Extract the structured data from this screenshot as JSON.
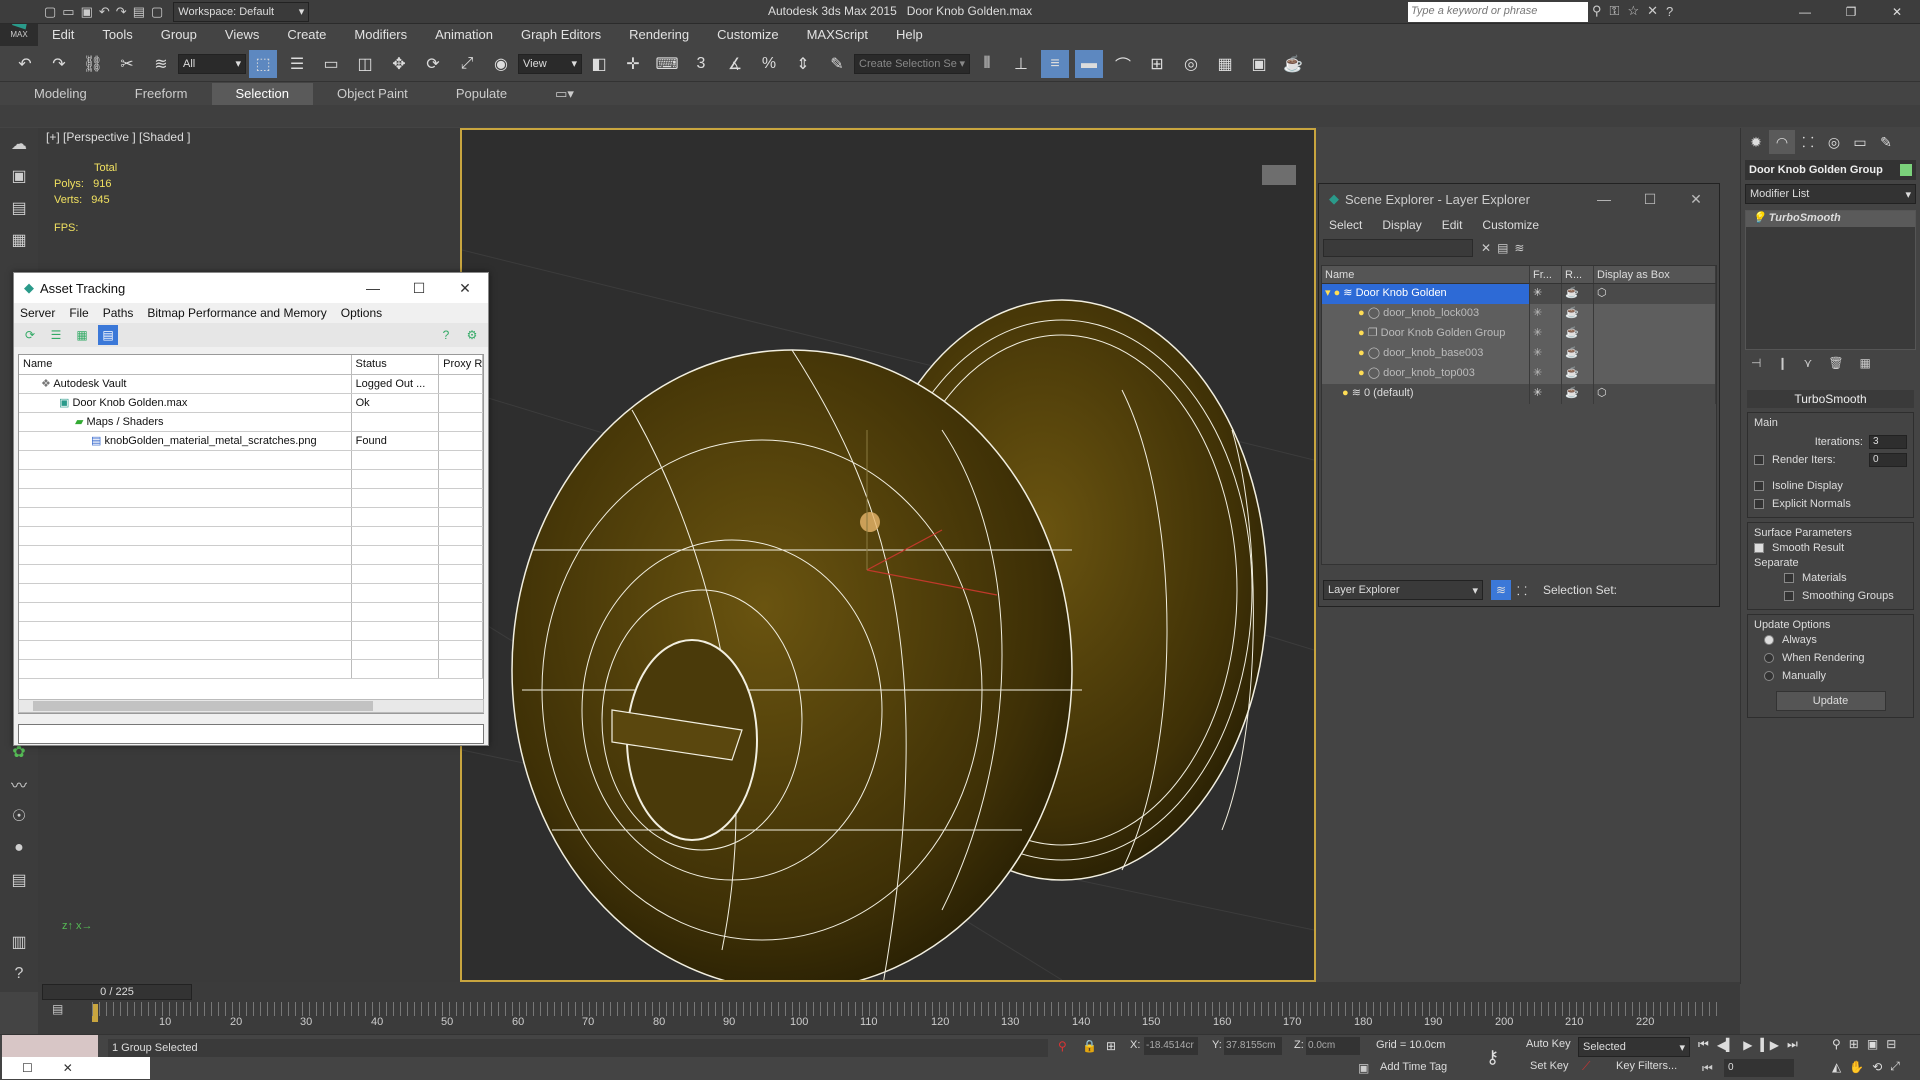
{
  "app": {
    "title": "Autodesk 3ds Max  2015",
    "file": "Door Knob Golden.max",
    "workspace": "Workspace: Default",
    "search_placeholder": "Type a keyword or phrase",
    "logo_text": "MAX"
  },
  "menu": [
    "Edit",
    "Tools",
    "Group",
    "Views",
    "Create",
    "Modifiers",
    "Animation",
    "Graph Editors",
    "Rendering",
    "Customize",
    "MAXScript",
    "Help"
  ],
  "toolbar": {
    "filter": "All",
    "refcoord": "View",
    "selset_placeholder": "Create Selection Se",
    "snaps": [
      "3",
      "n",
      "%",
      "n"
    ]
  },
  "ribbon": {
    "tabs": [
      "Modeling",
      "Freeform",
      "Selection",
      "Object Paint",
      "Populate"
    ],
    "active": "Selection"
  },
  "viewport": {
    "label": "[+] [Perspective ] [Shaded ]",
    "stats": {
      "total": "Total",
      "polys_label": "Polys:",
      "polys": "916",
      "verts_label": "Verts:",
      "verts": "945",
      "fps_label": "FPS:"
    }
  },
  "asset_tracking": {
    "title": "Asset Tracking",
    "menus": [
      "Server",
      "File",
      "Paths",
      "Bitmap Performance and Memory",
      "Options"
    ],
    "columns": [
      "Name",
      "Status",
      "Proxy R"
    ],
    "rows": [
      {
        "name": "Autodesk Vault",
        "status": "Logged Out ..."
      },
      {
        "name": "Door Knob Golden.max",
        "status": "Ok"
      },
      {
        "name": "Maps / Shaders",
        "status": ""
      },
      {
        "name": "knobGolden_material_metal_scratches.png",
        "status": "Found"
      }
    ]
  },
  "scene_explorer": {
    "title": "Scene Explorer - Layer Explorer",
    "menus": [
      "Select",
      "Display",
      "Edit",
      "Customize"
    ],
    "columns": [
      "Name",
      "Fr...",
      "R...",
      "Display as Box"
    ],
    "rows": [
      {
        "name": "Door Knob Golden"
      },
      {
        "name": "door_knob_lock003"
      },
      {
        "name": "Door Knob Golden Group"
      },
      {
        "name": "door_knob_base003"
      },
      {
        "name": "door_knob_top003"
      },
      {
        "name": "0 (default)"
      }
    ],
    "footer_combo": "Layer Explorer",
    "selection_set": "Selection Set:"
  },
  "command_panel": {
    "object_name": "Door Knob Golden Group",
    "modifier_list": "Modifier List",
    "stack_item": "TurboSmooth",
    "rollout_title": "TurboSmooth",
    "main_label": "Main",
    "iterations_label": "Iterations:",
    "iterations": "3",
    "render_iters_label": "Render Iters:",
    "render_iters": "0",
    "isoline": "Isoline Display",
    "explicit": "Explicit Normals",
    "surface_params": "Surface Parameters",
    "smooth_result": "Smooth Result",
    "separate": "Separate",
    "materials": "Materials",
    "smoothing_groups": "Smoothing Groups",
    "update_options": "Update Options",
    "always": "Always",
    "when_rendering": "When Rendering",
    "manually": "Manually",
    "update_button": "Update"
  },
  "timeline": {
    "frame": "0 / 225",
    "ticks": [
      "10",
      "20",
      "30",
      "40",
      "50",
      "60",
      "70",
      "80",
      "90",
      "100",
      "110",
      "120",
      "130",
      "140",
      "150",
      "160",
      "170",
      "180",
      "190",
      "200",
      "210",
      "220"
    ]
  },
  "status": {
    "selected": "1 Group Selected",
    "x_label": "X:",
    "x": "-18.4514cr",
    "y_label": "Y:",
    "y": "37.8155cm",
    "z_label": "Z:",
    "z": "0.0cm",
    "grid": "Grid = 10.0cm",
    "autokey": "Auto Key",
    "setkey": "Set Key",
    "selected_combo": "Selected",
    "key_filters": "Key Filters...",
    "add_time_tag": "Add Time Tag",
    "frame_field": "0"
  },
  "colors": {
    "accent": "#5d88c0",
    "selection": "#2d6ad6",
    "mesh": "#4a3a08",
    "wire": "#f2efe0",
    "viewport_border": "#c8a53f"
  }
}
